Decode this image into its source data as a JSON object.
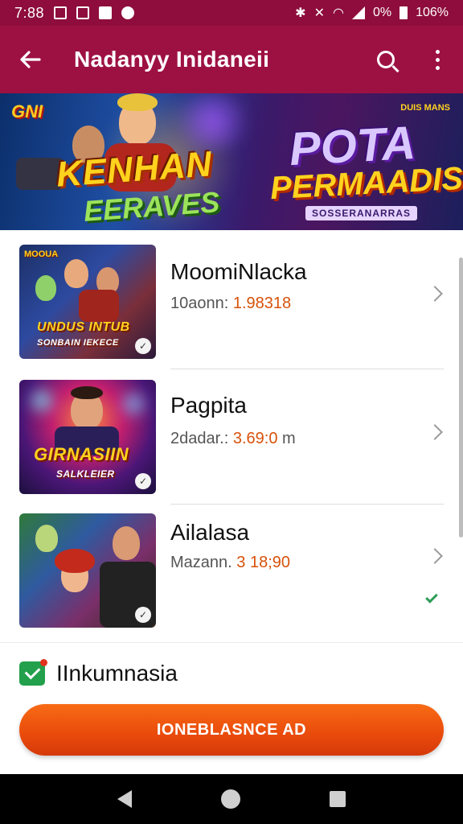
{
  "status_bar": {
    "time": "7:88",
    "network_text": "0%",
    "battery_text": "106%"
  },
  "app_bar": {
    "title": "Nadanyy Inidaneii",
    "icons": [
      "back-arrow-icon",
      "search-icon",
      "more-vert-icon"
    ]
  },
  "banner": {
    "logo": "GNI",
    "left_title": "KENHAN",
    "left_subtitle": "EERAVES",
    "right_title": "POTA",
    "right_subtitle": "PERMAADIS",
    "right_caption": "SOSSERANARRAS",
    "corner_text": "DUIS MANS"
  },
  "games": [
    {
      "name": "MoomiNlacka",
      "meta_label": "10aonn:",
      "meta_value": "1.98318",
      "thumb_caption": "UNDUS INTUB",
      "thumb_caption_sub": "SONBAIN IEKECE",
      "thumb_header": "MOOUA",
      "checked": false
    },
    {
      "name": "Pagpita",
      "meta_label": "2dadar.:",
      "meta_value": "3.69:0",
      "meta_suffix": "m",
      "thumb_caption": "GIRNASIIN",
      "thumb_caption_sub": "SALKLEIER",
      "checked": false
    },
    {
      "name": "Ailalasa",
      "meta_label": "Mazann.",
      "meta_value": "3 18;90",
      "checked": true
    }
  ],
  "bottom": {
    "verify_label": "IInkumnasia",
    "cta_label": "IONEBLASNCE AD"
  },
  "colors": {
    "status_bar": "#8e0d3c",
    "app_bar": "#9d1142",
    "cta": "#ef5a0f",
    "meta_value": "#d7520b",
    "check": "#2e9d56"
  }
}
